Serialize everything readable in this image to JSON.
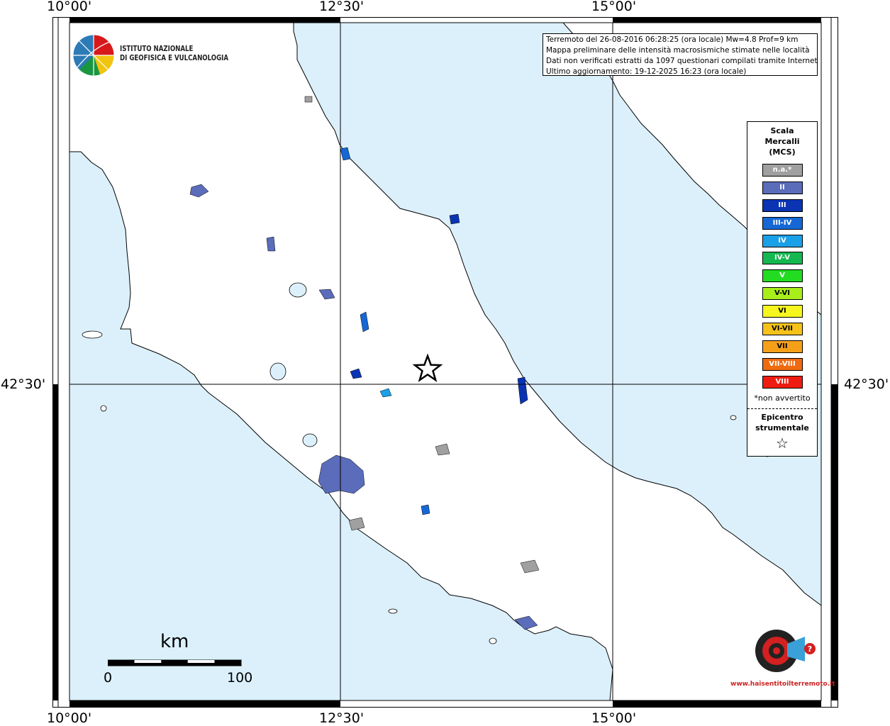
{
  "map": {
    "axes": {
      "top_lon_labels": [
        "10°00'",
        "12°30'",
        "15°00'"
      ],
      "bottom_lon_labels": [
        "10°00'",
        "12°30'",
        "15°00'"
      ],
      "left_lat_label": "42°30'",
      "right_lat_label": "42°30'"
    },
    "colors": {
      "sea": "#dcf0fc",
      "land": "#ffffff",
      "coast": "#000000",
      "grid": "#000000"
    },
    "header": {
      "lines": [
        "Terremoto del 26-08-2016 06:28:25 (ora locale) Mw=4.8 Prof=9 km",
        "Mappa preliminare delle intensità macrosismiche stimate nelle località",
        "Dati non verificati estratti da 1097 questionari compilati tramite Internet.",
        "Ultimo aggiornamento: 19-12-2025 16:23 (ora locale)"
      ]
    },
    "logo": {
      "line1": "ISTITUTO NAZIONALE",
      "line2": "DI GEOFISICA E VULCANOLOGIA"
    },
    "legend": {
      "title_lines": [
        "Scala",
        "Mercalli",
        "(MCS)"
      ],
      "items": [
        {
          "label": "n.a.*",
          "color": "#a0a0a0"
        },
        {
          "label": "II",
          "color": "#5a6cba"
        },
        {
          "label": "III",
          "color": "#0a34b4"
        },
        {
          "label": "III-IV",
          "color": "#1567d6"
        },
        {
          "label": "IV",
          "color": "#1aa0e6"
        },
        {
          "label": "IV-V",
          "color": "#15b850"
        },
        {
          "label": "V",
          "color": "#22dc22"
        },
        {
          "label": "V-VI",
          "color": "#a8ee1a"
        },
        {
          "label": "VI",
          "color": "#f6f61e"
        },
        {
          "label": "VI-VII",
          "color": "#f6c21a"
        },
        {
          "label": "VII",
          "color": "#f6a01a"
        },
        {
          "label": "VII-VIII",
          "color": "#f06a10"
        },
        {
          "label": "VIII",
          "color": "#ee1c10"
        }
      ],
      "note": "*non avvertito",
      "epicenter_lines": [
        "Epicentro",
        "strumentale"
      ],
      "epicenter_symbol": "☆"
    },
    "scale": {
      "unit": "km",
      "min_label": "0",
      "max_label": "100"
    },
    "epicenter": {
      "symbol": "star"
    },
    "watermark": {
      "text": "hai sentito il terremoto.it",
      "url_text": "www.haisentitoilterremoto.it",
      "question": "?"
    }
  }
}
